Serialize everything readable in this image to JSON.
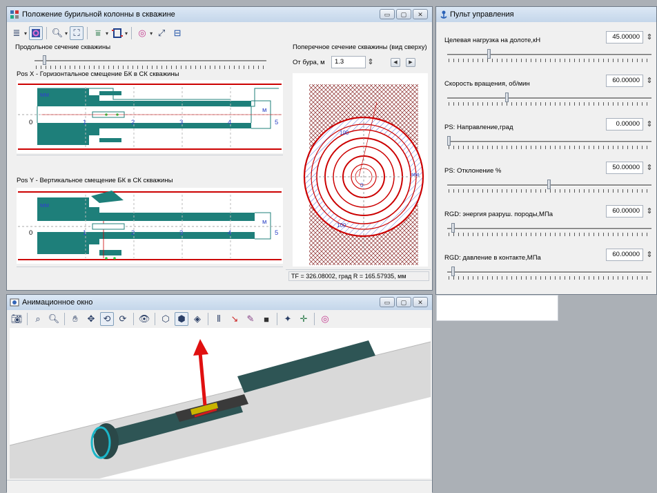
{
  "drill_window": {
    "title": "Положение бурильной колонны в скважине",
    "window_buttons": [
      "▭",
      "▢",
      "✕"
    ],
    "long_section_label": "Продольное сечение скважины",
    "panel_x": {
      "title": "Pos X - Горизонтальное смещение БК в СК скважины",
      "unit_left": "мм",
      "unit_right": "м",
      "ticks": [
        "0",
        "1",
        "2",
        "3",
        "4",
        "5"
      ]
    },
    "panel_y": {
      "title": "Pos Y - Вертикальное смещение БК в СК скважины",
      "unit_left": "мм",
      "unit_right": "м",
      "ticks": [
        "0",
        "1",
        "2",
        "3",
        "4",
        "5"
      ]
    },
    "cross_section": {
      "label": "Поперечное сечение скважины (вид сверху)",
      "from_label": "От бура, м",
      "from_value": "1.3",
      "ring_labels": [
        "100",
        "100",
        "0"
      ],
      "unit": "мм"
    },
    "status": "TF = 326.08002, град  R = 165.57935, мм",
    "slider_value": 0.03
  },
  "control_panel": {
    "title": "Пульт управления",
    "params": [
      {
        "label": "Целевая нагрузка на долоте,кН",
        "value": "45.00000",
        "level": 0.2
      },
      {
        "label": "Скорость вращения, об/мин",
        "value": "60.00000",
        "level": 0.29
      },
      {
        "label": "PS: Направление,град",
        "value": "0.00000",
        "level": 0.0
      },
      {
        "label": "PS: Отклонение %",
        "value": "50.00000",
        "level": 0.5
      },
      {
        "label": "RGD: энергия разруш. породы,МПа",
        "value": "60.00000",
        "level": 0.02
      },
      {
        "label": "RGD: давление в контакте,МПа",
        "value": "60.00000",
        "level": 0.02
      }
    ]
  },
  "anim_window": {
    "title": "Анимационное окно",
    "window_buttons": [
      "▭",
      "▢",
      "✕"
    ]
  },
  "colors": {
    "teal": "#1e7f7a",
    "red": "#cc0000",
    "hatch": "#8b2a2a",
    "blue_hatch": "#3b4fd1"
  }
}
